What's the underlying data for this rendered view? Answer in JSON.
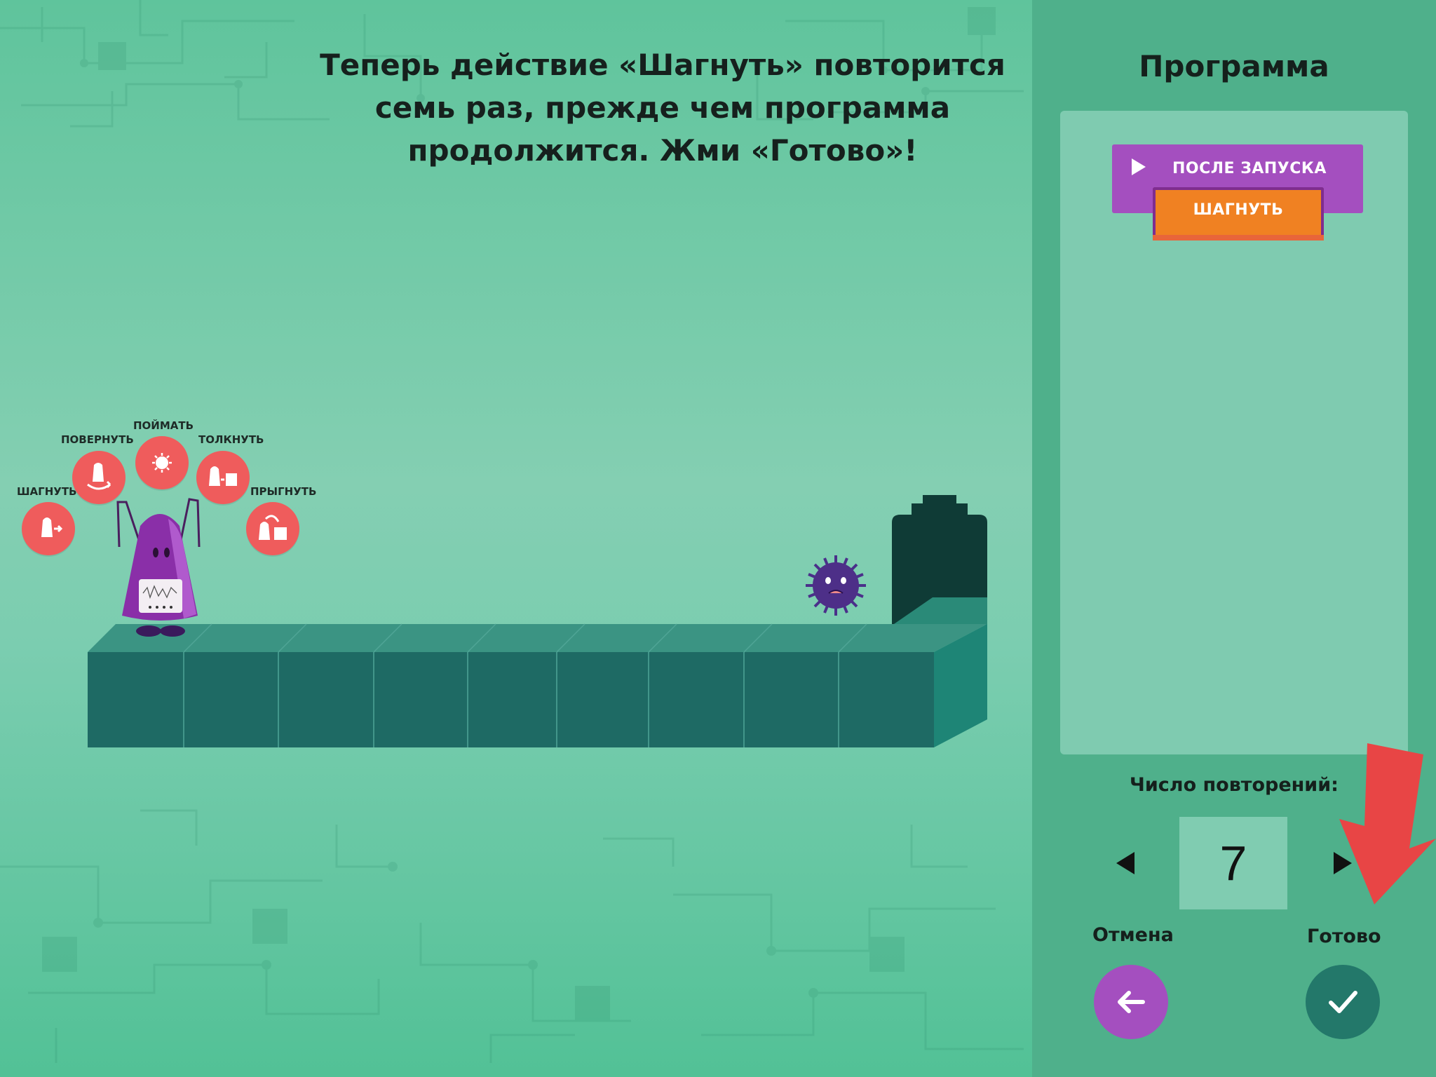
{
  "instruction": "Теперь действие «Шагнуть» повторится семь раз, прежде чем программа продолжится. Жми «Готово»!",
  "actions": [
    {
      "label": "ШАГНУТЬ",
      "icon": "step-icon"
    },
    {
      "label": "ПОВЕРНУТЬ",
      "icon": "turn-icon"
    },
    {
      "label": "ПОЙМАТЬ",
      "icon": "catch-icon"
    },
    {
      "label": "ТОЛКНУТЬ",
      "icon": "push-icon"
    },
    {
      "label": "ПРЫГНУТЬ",
      "icon": "jump-icon"
    }
  ],
  "panel": {
    "title": "Программа",
    "hat_block": "ПОСЛЕ ЗАПУСКА",
    "step_block": "ШАГНУТЬ",
    "repeat_label": "Число повторений:",
    "repeat_value": "7",
    "cancel_label": "Отмена",
    "done_label": "Готово"
  },
  "colors": {
    "accent_purple": "#a44fbf",
    "accent_orange": "#f08122",
    "action_red": "#ef5c5c",
    "done_teal": "#23786a",
    "hint_arrow": "#e84545"
  }
}
